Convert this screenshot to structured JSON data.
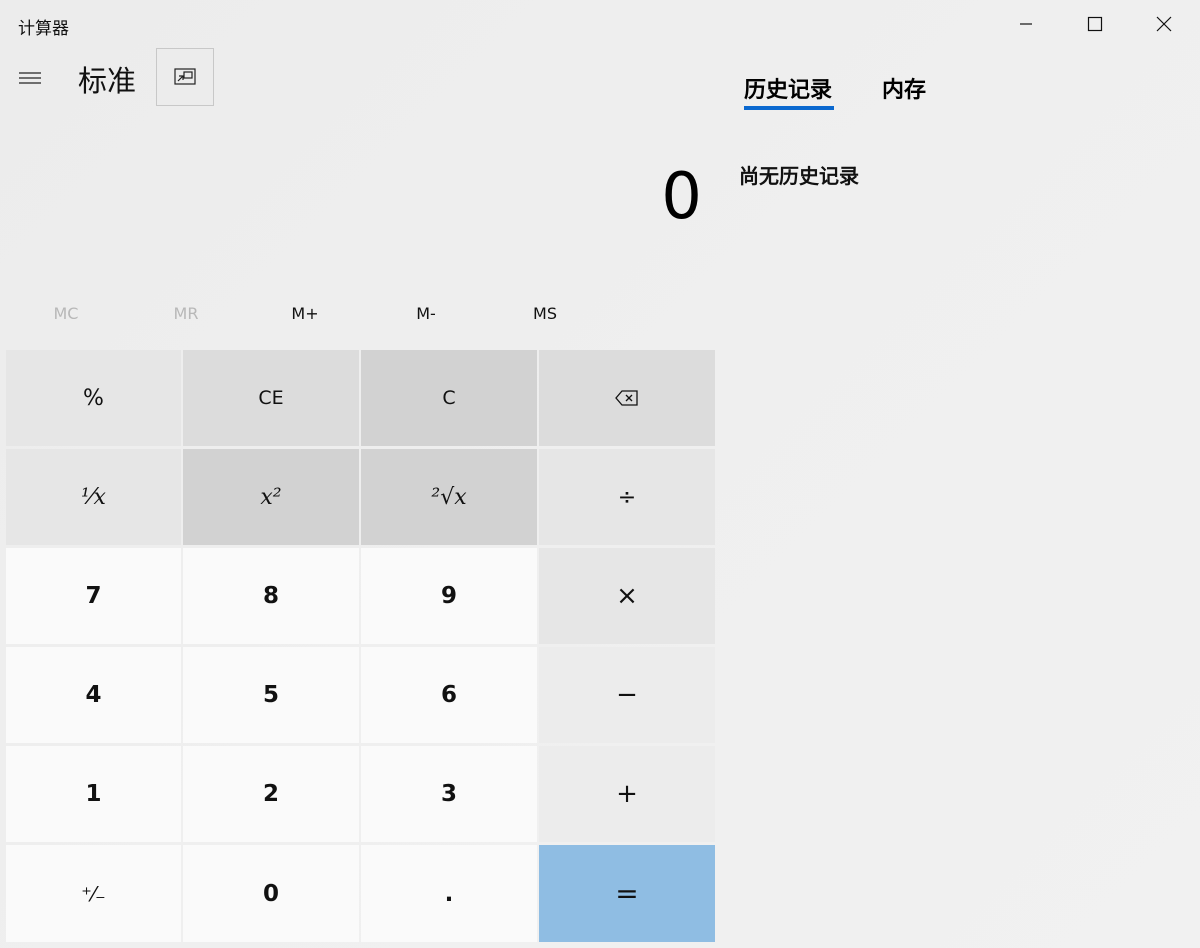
{
  "window": {
    "title": "计算器",
    "minimize_icon": "minimize-icon",
    "maximize_icon": "maximize-icon",
    "close_icon": "close-icon"
  },
  "header": {
    "menu_icon": "hamburger-menu-icon",
    "mode": "标准",
    "keep_on_top_icon": "keep-on-top-icon"
  },
  "display": {
    "value": "0"
  },
  "side_panel": {
    "tabs": [
      {
        "label": "历史记录",
        "selected": true
      },
      {
        "label": "内存",
        "selected": false
      }
    ],
    "empty_message": "尚无历史记录",
    "accent": "#0a68cf"
  },
  "memory": [
    {
      "label": "MC",
      "enabled": false
    },
    {
      "label": "MR",
      "enabled": false
    },
    {
      "label": "M+",
      "enabled": true
    },
    {
      "label": "M-",
      "enabled": true
    },
    {
      "label": "MS",
      "enabled": true
    }
  ],
  "keys": {
    "percent": "%",
    "ce": "CE",
    "c": "C",
    "backspace_icon": "backspace-icon",
    "reciprocal": "¹⁄x",
    "square": "x²",
    "sqrt": "²√x",
    "divide": "÷",
    "seven": "7",
    "eight": "8",
    "nine": "9",
    "multiply": "×",
    "four": "4",
    "five": "5",
    "six": "6",
    "minus": "−",
    "one": "1",
    "two": "2",
    "three": "3",
    "plus": "+",
    "negate": "⁺⁄₋",
    "zero": "0",
    "decimal": ".",
    "equals": "=",
    "equals_color": "#8fbde3"
  }
}
